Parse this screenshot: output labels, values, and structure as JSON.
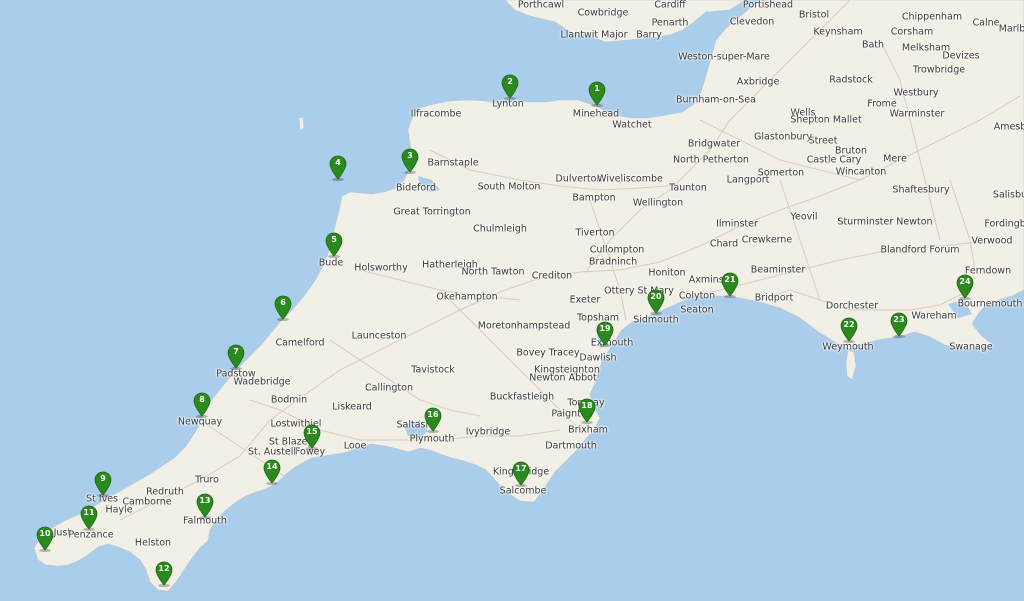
{
  "colors": {
    "sea": "#a9cdea",
    "land": "#f1efe6",
    "road": "#d2cbb8",
    "marker": "#2a8a1e",
    "marker_dark": "#1d6614"
  },
  "places": [
    "Porthcawl",
    "Cowbridge",
    "Cardiff",
    "Llantwit Major",
    "Penarth",
    "Barry",
    "Portishead",
    "Clevedon",
    "Bristol",
    "Chippenham",
    "Calne",
    "Corsham",
    "Marlb",
    "Keynsham",
    "Bath",
    "Melksham",
    "Devizes",
    "Weston-super-Mare",
    "Axbridge",
    "Radstock",
    "Trowbridge",
    "Burnham-on-Sea",
    "Westbury",
    "Frome",
    "Warminster",
    "Amesb",
    "Wells",
    "Shepton Mallet",
    "Lynton",
    "Minehead",
    "Ilfracombe",
    "Watchet",
    "Bridgwater",
    "Glastonbury",
    "North Petherton",
    "Street",
    "Bruton",
    "Castle Cary",
    "Mere",
    "Barnstaple",
    "Bideford",
    "South Molton",
    "Dulverton",
    "Wiveliscombe",
    "Taunton",
    "Langport",
    "Somerton",
    "Wincanton",
    "Shaftesbury",
    "Salisbu",
    "Great Torrington",
    "Bampton",
    "Wellington",
    "Ilminster",
    "Yeovil",
    "Sturminster Newton",
    "Fordingbr",
    "Chulmleigh",
    "Tiverton",
    "Chard",
    "Crewkerne",
    "Blandford Forum",
    "Verwood",
    "Cullompton",
    "Bradninch",
    "Bude",
    "Holsworthy",
    "Hatherleigh",
    "North Tawton",
    "Crediton",
    "Honiton",
    "Axminster",
    "Beaminster",
    "Ferndown",
    "Okehampton",
    "Exeter",
    "Ottery St Mary",
    "Colyton",
    "Bridport",
    "Bournemouth",
    "Topsham",
    "Sidmouth",
    "Seaton",
    "Dorchester",
    "Wareham",
    "Camelford",
    "Launceston",
    "Moretonhampstead",
    "Exmouth",
    "Weymouth",
    "Swanage",
    "Dawlish",
    "Bovey Tracey",
    "Padstow",
    "Kingsteignton",
    "Newton Abbot",
    "Tavistock",
    "Wadebridge",
    "Callington",
    "Bodmin",
    "Liskeard",
    "Buckfastleigh",
    "Torquay",
    "Paignton",
    "Newquay",
    "Lostwithiel",
    "Saltash",
    "Brixham",
    "St Blazey",
    "Fowey",
    "Looe",
    "Plymouth",
    "Ivybridge",
    "Dartmouth",
    "St. Austell",
    "Truro",
    "Kingsbridge",
    "St Ives",
    "Redruth",
    "Camborne",
    "Hayle",
    "Salcombe",
    "Falmouth",
    "St Just",
    "Penzance",
    "Helston"
  ],
  "markers": [
    "1",
    "2",
    "3",
    "4",
    "5",
    "6",
    "7",
    "8",
    "9",
    "10",
    "11",
    "12",
    "13",
    "14",
    "15",
    "16",
    "17",
    "18",
    "19",
    "20",
    "21",
    "22",
    "23",
    "24"
  ]
}
